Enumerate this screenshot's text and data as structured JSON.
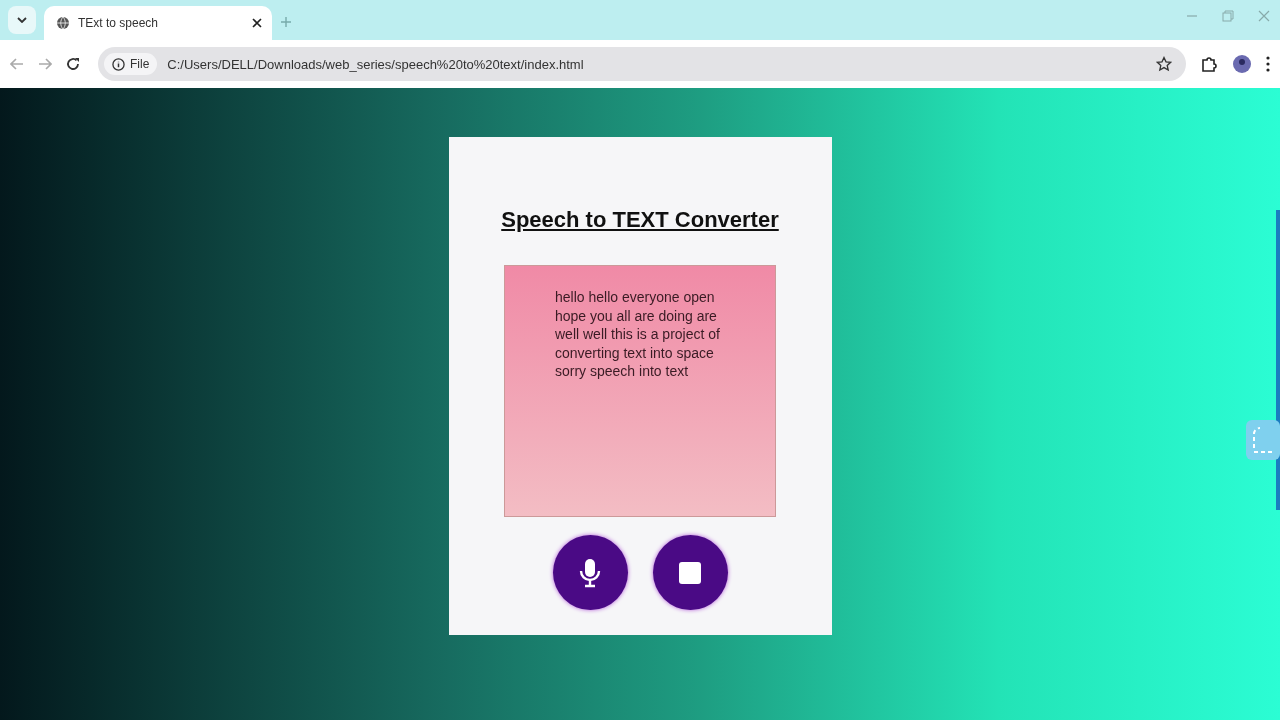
{
  "browser": {
    "tab": {
      "title": "TExt to speech",
      "selected": true
    },
    "address": {
      "scheme_label": "File",
      "url": "C:/Users/DELL/Downloads/web_series/speech%20to%20text/index.html"
    }
  },
  "page": {
    "title": "Speech to TEXT Converter",
    "transcript": "hello hello everyone open hope you all are doing are well well this is a project of converting text into space sorry speech into text"
  }
}
